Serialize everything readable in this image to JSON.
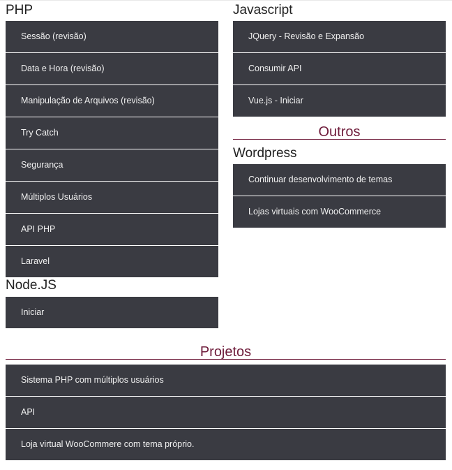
{
  "php": {
    "heading": "PHP",
    "items": [
      "Sessão (revisão)",
      "Data e Hora (revisão)",
      "Manipulação de Arquivos (revisão)",
      "Try Catch",
      "Segurança",
      "Múltiplos Usuários",
      "API PHP",
      "Laravel"
    ]
  },
  "nodejs": {
    "heading": "Node.JS",
    "items": [
      "Iniciar"
    ]
  },
  "javascript": {
    "heading": "Javascript",
    "items": [
      "JQuery - Revisão e Expansão",
      "Consumir API",
      "Vue.js - Iniciar"
    ]
  },
  "outros": {
    "title": "Outros"
  },
  "wordpress": {
    "heading": "Wordpress",
    "items": [
      "Continuar desenvolvimento de temas",
      "Lojas virtuais com WooCommerce"
    ]
  },
  "projetos": {
    "title": "Projetos",
    "items": [
      "Sistema PHP com múltiplos usuários",
      "API",
      "Loja virtual WooCommere com tema próprio."
    ]
  },
  "colors": {
    "item_bg": "#3a3b42",
    "item_text": "#f0f0f0",
    "accent": "#6e1b3a"
  }
}
